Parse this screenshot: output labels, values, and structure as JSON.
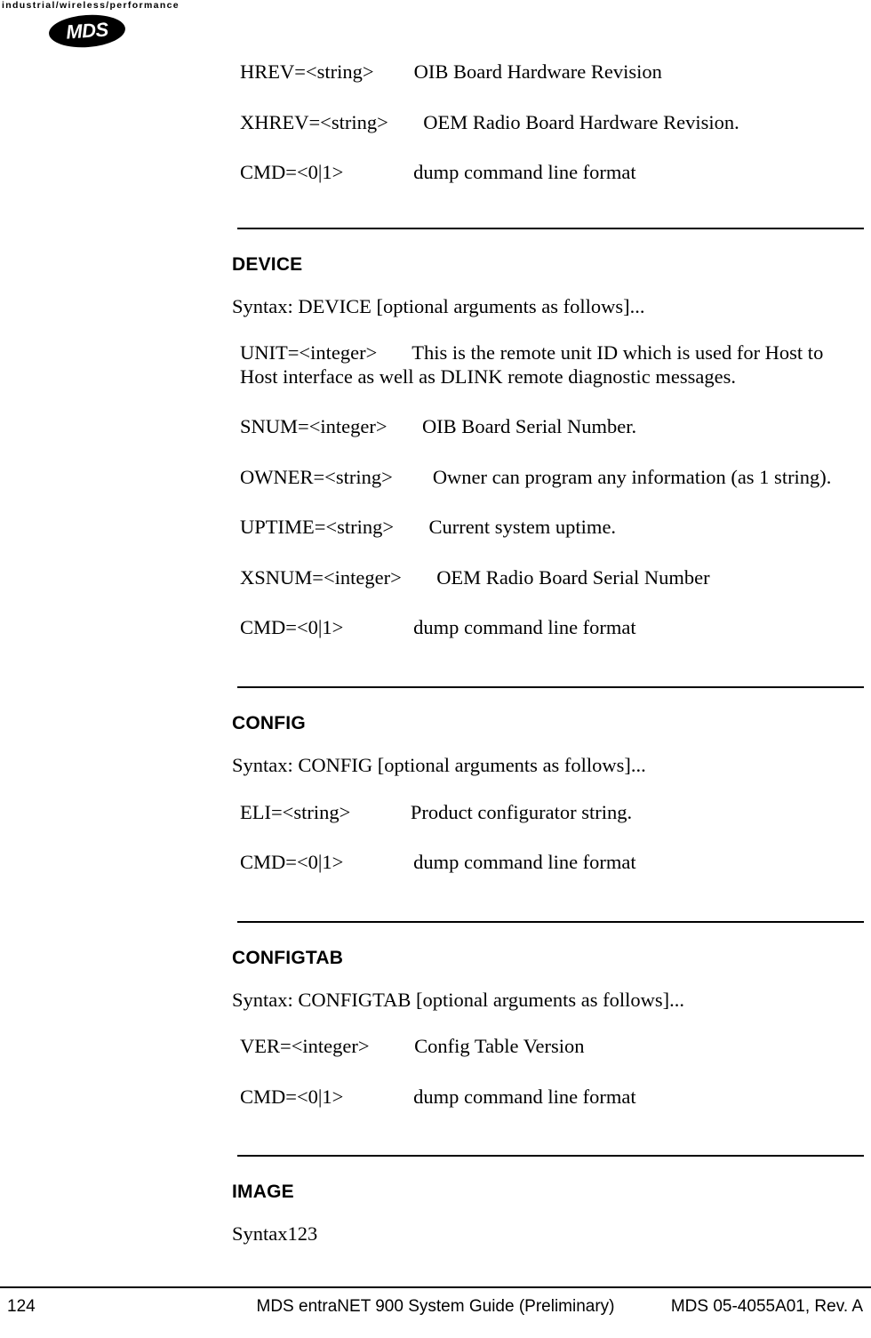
{
  "header": {
    "tagline": "industrial/wireless/performance",
    "logo_text": "MDS"
  },
  "top_args": [
    {
      "param": "HREV=<string>",
      "pad": "        ",
      "desc": "OIB Board Hardware Revision"
    },
    {
      "param": "XHREV=<string>",
      "pad": "       ",
      "desc": "OEM Radio Board Hardware Revision."
    },
    {
      "param": "CMD=<0|1>",
      "pad": "              ",
      "desc": "dump command line format"
    }
  ],
  "sections": [
    {
      "heading": "DEVICE",
      "syntax": "Syntax: DEVICE [optional arguments as follows]...",
      "args": [
        {
          "param": "UNIT=<integer>",
          "pad": "       ",
          "desc": "This is the remote unit ID which is used for Host to Host interface as well as DLINK remote diagnostic messages."
        },
        {
          "param": "SNUM=<integer>",
          "pad": "       ",
          "desc": "OIB Board Serial Number."
        },
        {
          "param": "OWNER=<string>",
          "pad": "        ",
          "desc": "Owner can program any information (as 1 string)."
        },
        {
          "param": "UPTIME=<string>",
          "pad": "       ",
          "desc": "Current system uptime."
        },
        {
          "param": "XSNUM=<integer>",
          "pad": "       ",
          "desc": "OEM Radio Board Serial Number"
        },
        {
          "param": "CMD=<0|1>",
          "pad": "              ",
          "desc": "dump command line format"
        }
      ]
    },
    {
      "heading": "CONFIG",
      "syntax": "Syntax: CONFIG [optional arguments as follows]...",
      "args": [
        {
          "param": "ELI=<string>",
          "pad": "            ",
          "desc": "Product configurator string."
        },
        {
          "param": "CMD=<0|1>",
          "pad": "              ",
          "desc": "dump command line format"
        }
      ]
    },
    {
      "heading": "CONFIGTAB",
      "syntax": "Syntax: CONFIGTAB [optional arguments as follows]...",
      "args": [
        {
          "param": "VER=<integer>",
          "pad": "         ",
          "desc": "Config Table Version"
        },
        {
          "param": "CMD=<0|1>",
          "pad": "              ",
          "desc": "dump command line format"
        }
      ]
    },
    {
      "heading": "IMAGE",
      "syntax": "Syntax123",
      "args": []
    }
  ],
  "footer": {
    "page_number": "124",
    "title": "MDS entraNET 900 System Guide (Preliminary)",
    "doc_number": "MDS 05-4055A01, Rev. A"
  }
}
